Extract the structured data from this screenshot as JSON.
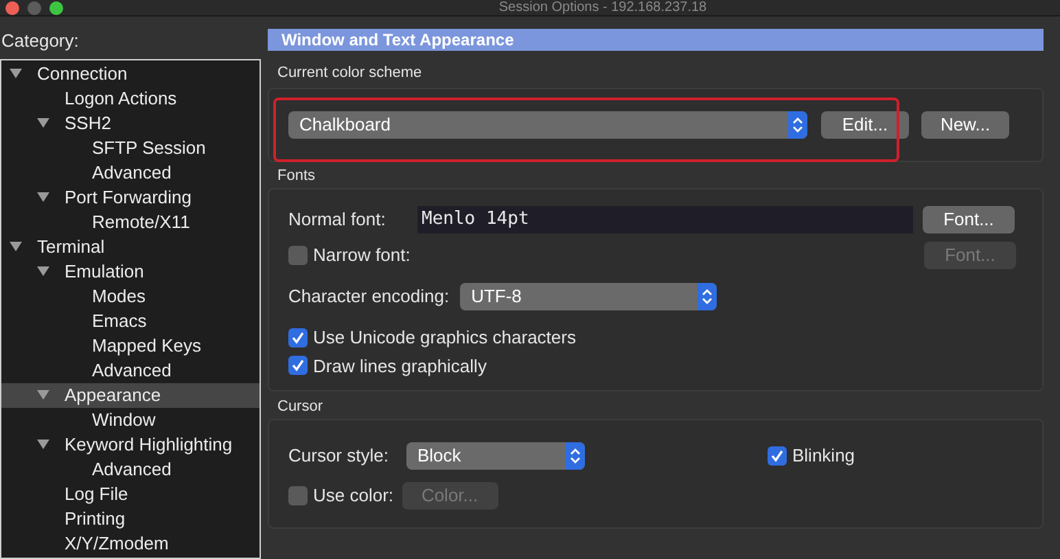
{
  "window": {
    "title": "Session Options - 192.168.237.18"
  },
  "category": {
    "label": "Category:",
    "tree": [
      {
        "label": "Connection",
        "expanded": true,
        "selected": false,
        "children": [
          {
            "label": "Logon Actions",
            "selected": false
          },
          {
            "label": "SSH2",
            "expanded": true,
            "selected": false,
            "children": [
              {
                "label": "SFTP Session",
                "selected": false
              },
              {
                "label": "Advanced",
                "selected": false
              }
            ]
          },
          {
            "label": "Port Forwarding",
            "expanded": true,
            "selected": false,
            "children": [
              {
                "label": "Remote/X11",
                "selected": false
              }
            ]
          }
        ]
      },
      {
        "label": "Terminal",
        "expanded": true,
        "selected": false,
        "children": [
          {
            "label": "Emulation",
            "expanded": true,
            "selected": false,
            "children": [
              {
                "label": "Modes",
                "selected": false
              },
              {
                "label": "Emacs",
                "selected": false
              },
              {
                "label": "Mapped Keys",
                "selected": false
              },
              {
                "label": "Advanced",
                "selected": false
              }
            ]
          },
          {
            "label": "Appearance",
            "expanded": true,
            "selected": true,
            "children": [
              {
                "label": "Window",
                "selected": false
              }
            ]
          },
          {
            "label": "Keyword Highlighting",
            "expanded": true,
            "selected": false,
            "children": [
              {
                "label": "Advanced",
                "selected": false
              }
            ]
          },
          {
            "label": "Log File",
            "selected": false
          },
          {
            "label": "Printing",
            "selected": false
          },
          {
            "label": "X/Y/Zmodem",
            "selected": false
          }
        ]
      }
    ]
  },
  "panel": {
    "title": "Window and Text Appearance",
    "color_scheme": {
      "label": "Current color scheme",
      "value": "Chalkboard",
      "highlighted": true,
      "buttons": [
        "Edit...",
        "New..."
      ]
    },
    "fonts": {
      "label": "Fonts",
      "normal_font": {
        "label": "Normal font:",
        "value": "Menlo 14pt",
        "button": "Font..."
      },
      "narrow_font": {
        "label": "Narrow font:",
        "checked": false,
        "button": "Font...",
        "button_disabled": true
      },
      "encoding": {
        "label": "Character encoding:",
        "value": "UTF-8"
      },
      "options": [
        {
          "label": "Use Unicode graphics characters",
          "checked": true
        },
        {
          "label": "Draw lines graphically",
          "checked": true
        }
      ]
    },
    "cursor": {
      "label": "Cursor",
      "style": {
        "label": "Cursor style:",
        "value": "Block"
      },
      "blinking": {
        "label": "Blinking",
        "checked": true
      },
      "use_color": {
        "label": "Use color:",
        "checked": false,
        "button": "Color...",
        "button_disabled": true
      }
    }
  }
}
